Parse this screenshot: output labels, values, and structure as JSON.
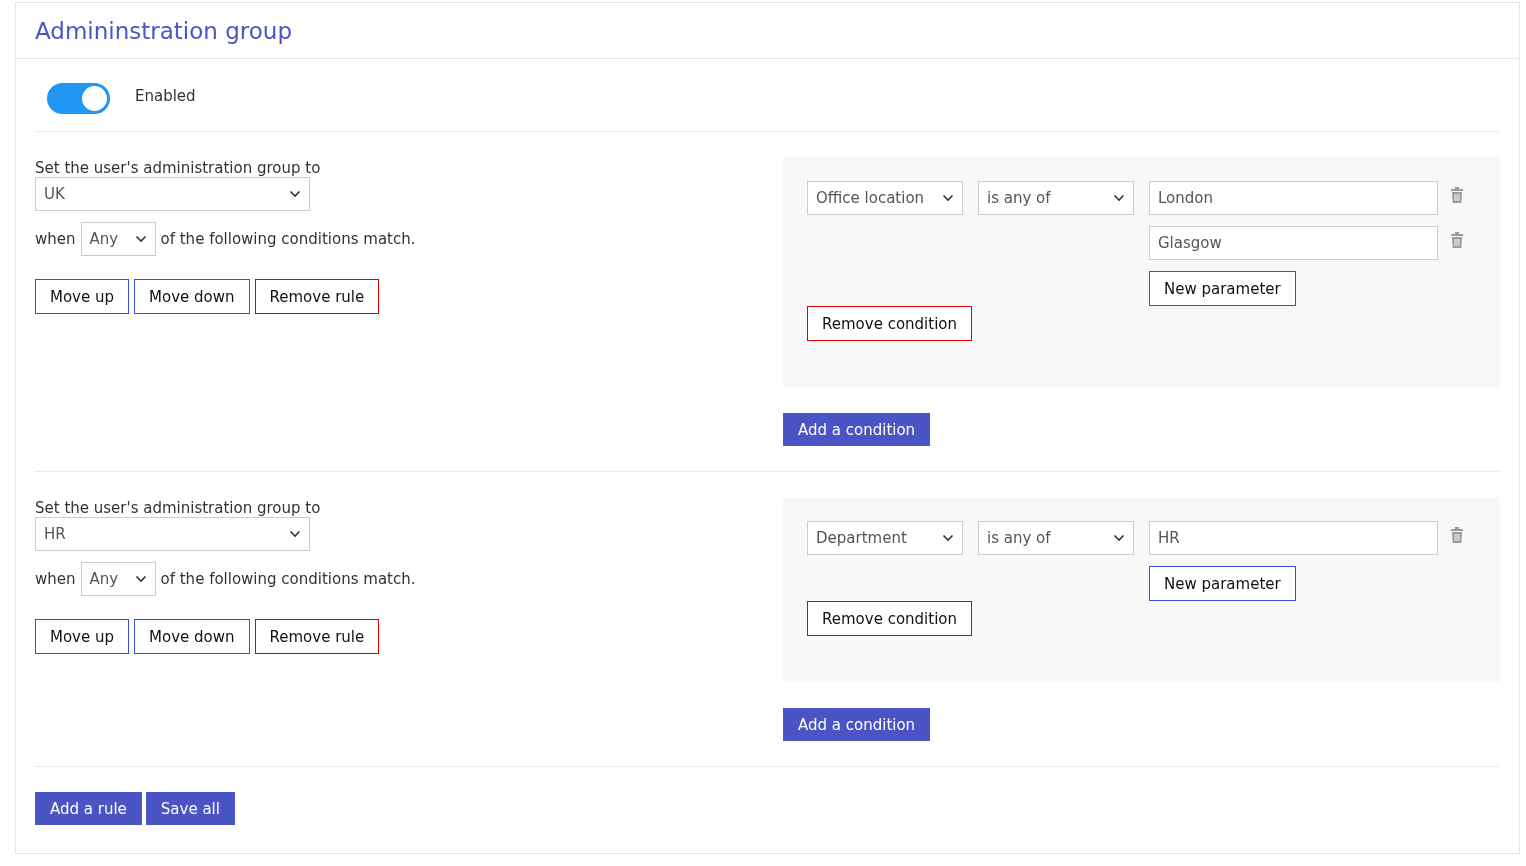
{
  "card": {
    "title": "Admininstration group"
  },
  "enabled": {
    "label": "Enabled",
    "on": true
  },
  "rules": [
    {
      "label": "Set the user's administration group to",
      "group": "UK",
      "when_label": "when",
      "match": "Any",
      "match_suffix": "of the following conditions match.",
      "buttons": [
        {
          "label": "Move up",
          "kind": "outline"
        },
        {
          "label": "Move down",
          "kind": "outline"
        },
        {
          "label": "Remove rule",
          "kind": "danger"
        }
      ],
      "conditions": [
        {
          "field": "Office location",
          "operator": "is any of",
          "parameters": [
            "London",
            "Glasgow"
          ],
          "new_parameter": "New parameter",
          "remove": "Remove condition"
        }
      ],
      "add_condition": "Add a condition"
    },
    {
      "label": "Set the user's administration group to",
      "group": "HR",
      "when_label": "when",
      "match": "Any",
      "match_suffix": "of the following conditions match.",
      "buttons": [
        {
          "label": "Move up",
          "kind": "outline"
        },
        {
          "label": "Move down",
          "kind": "outline"
        },
        {
          "label": "Remove rule",
          "kind": "danger"
        }
      ],
      "conditions": [
        {
          "field": "Department",
          "operator": "is any of",
          "parameters": [
            "HR"
          ],
          "new_parameter": "New parameter",
          "remove": "Remove condition"
        }
      ],
      "add_condition": "Add a condition"
    }
  ],
  "actions": [
    {
      "label": "Add a rule",
      "kind": "primary"
    },
    {
      "label": "Save all",
      "kind": "primary"
    }
  ]
}
